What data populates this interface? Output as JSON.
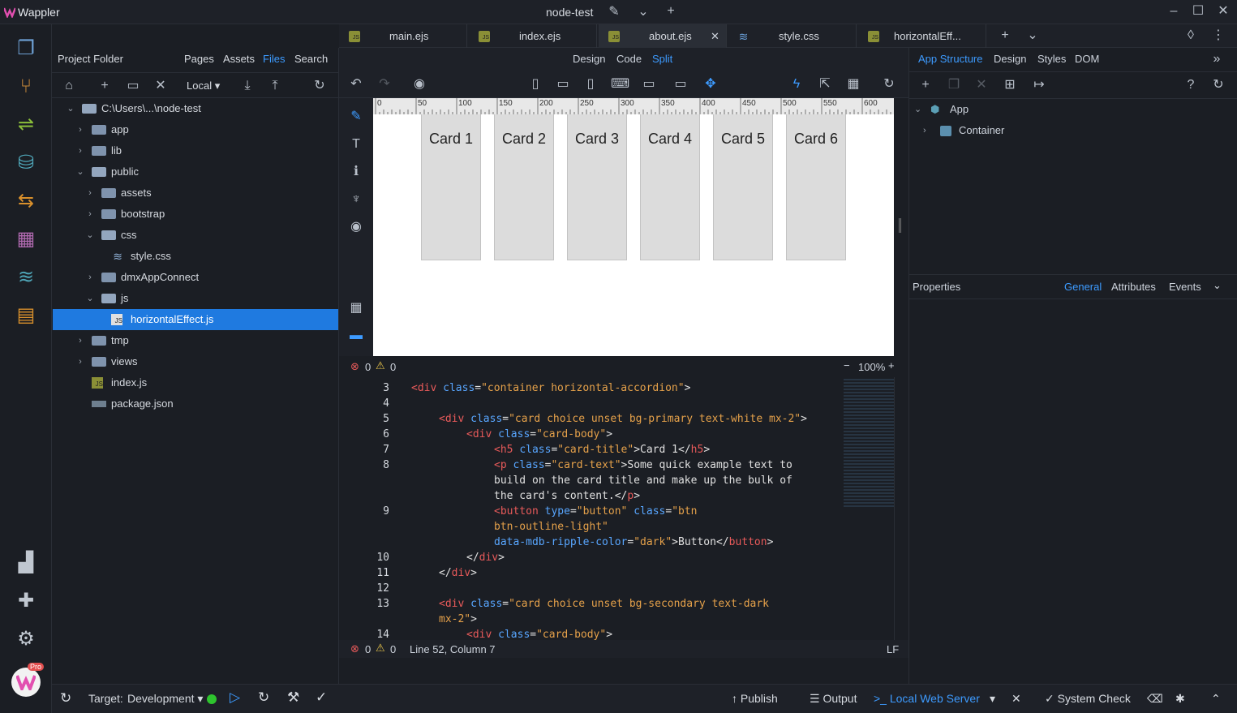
{
  "app": {
    "name": "Wappler",
    "project": "node-test"
  },
  "file_tabs": [
    {
      "label": "main.ejs",
      "icon": "js-file-icon",
      "active": false
    },
    {
      "label": "index.ejs",
      "icon": "js-file-icon",
      "active": false
    },
    {
      "label": "about.ejs",
      "icon": "js-file-icon",
      "active": true
    },
    {
      "label": "style.css",
      "icon": "css-file-icon",
      "active": false
    },
    {
      "label": "horizontalEff...",
      "icon": "js-file-icon",
      "active": false
    }
  ],
  "project_panel": {
    "title": "Project Folder",
    "tabs": [
      "Pages",
      "Assets",
      "Files",
      "Search"
    ],
    "active_tab": "Files",
    "location": "Local",
    "tree": [
      {
        "label": "C:\\Users\\...\\node-test",
        "depth": 0,
        "type": "folder-open"
      },
      {
        "label": "app",
        "depth": 1,
        "type": "folder"
      },
      {
        "label": "lib",
        "depth": 1,
        "type": "folder"
      },
      {
        "label": "public",
        "depth": 1,
        "type": "folder-open"
      },
      {
        "label": "assets",
        "depth": 2,
        "type": "folder"
      },
      {
        "label": "bootstrap",
        "depth": 2,
        "type": "folder"
      },
      {
        "label": "css",
        "depth": 2,
        "type": "folder-open"
      },
      {
        "label": "style.css",
        "depth": 3,
        "type": "css"
      },
      {
        "label": "dmxAppConnect",
        "depth": 2,
        "type": "folder"
      },
      {
        "label": "js",
        "depth": 2,
        "type": "folder-open"
      },
      {
        "label": "horizontalEffect.js",
        "depth": 3,
        "type": "js",
        "selected": true
      },
      {
        "label": "tmp",
        "depth": 1,
        "type": "folder"
      },
      {
        "label": "views",
        "depth": 1,
        "type": "folder"
      },
      {
        "label": "index.js",
        "depth": 1,
        "type": "js"
      },
      {
        "label": "package.json",
        "depth": 1,
        "type": "json"
      }
    ]
  },
  "view_modes": {
    "design": "Design",
    "code": "Code",
    "split": "Split",
    "active": "Split"
  },
  "ruler_ticks": [
    "0",
    "50",
    "100",
    "150",
    "200",
    "250",
    "300",
    "350",
    "400",
    "450",
    "500",
    "550",
    "600"
  ],
  "cards": [
    "Card 1",
    "Card 2",
    "Card 3",
    "Card 4",
    "Card 5",
    "Card 6"
  ],
  "canvas_status": {
    "errors": "0",
    "warnings": "0",
    "zoom": "100%"
  },
  "code_lines": [
    {
      "n": "3",
      "html": "<span class='etag'>&lt;div</span> <span class='att'>class</span>=<span class='str'>\"container horizontal-accordion\"</span>&gt;",
      "indent": 0
    },
    {
      "n": "4",
      "html": "",
      "indent": 0
    },
    {
      "n": "5",
      "html": "<span class='etag'>&lt;div</span> <span class='att'>class</span>=<span class='str'>\"card choice unset bg-primary text-white mx-2\"</span>&gt;",
      "indent": 1
    },
    {
      "n": "6",
      "html": "<span class='etag'>&lt;div</span> <span class='att'>class</span>=<span class='str'>\"card-body\"</span>&gt;",
      "indent": 2
    },
    {
      "n": "7",
      "html": "<span class='etag'>&lt;h5</span> <span class='att'>class</span>=<span class='str'>\"card-title\"</span>&gt;Card 1&lt;/<span class='etag'>h5</span>&gt;",
      "indent": 3
    },
    {
      "n": "8",
      "html": "<span class='etag'>&lt;p</span> <span class='att'>class</span>=<span class='str'>\"card-text\"</span>&gt;Some quick example text to",
      "indent": 3
    },
    {
      "n": "",
      "html": "build on the card title and make up the bulk of",
      "indent": 3
    },
    {
      "n": "",
      "html": "the card's content.&lt;/<span class='etag'>p</span>&gt;",
      "indent": 3
    },
    {
      "n": "9",
      "html": "<span class='etag'>&lt;button</span> <span class='att'>type</span>=<span class='str'>\"button\"</span> <span class='att'>class</span>=<span class='str'>\"btn</span>",
      "indent": 3
    },
    {
      "n": "",
      "html": "<span class='str'>btn-outline-light\"</span>",
      "indent": 3
    },
    {
      "n": "",
      "html": "<span class='att'>data-mdb-ripple-color</span>=<span class='str'>\"dark\"</span>&gt;Button&lt;/<span class='etag'>button</span>&gt;",
      "indent": 3
    },
    {
      "n": "10",
      "html": "&lt;/<span class='etag'>div</span>&gt;",
      "indent": 2
    },
    {
      "n": "11",
      "html": "&lt;/<span class='etag'>div</span>&gt;",
      "indent": 1
    },
    {
      "n": "12",
      "html": "",
      "indent": 0
    },
    {
      "n": "13",
      "html": "<span class='etag'>&lt;div</span> <span class='att'>class</span>=<span class='str'>\"card choice unset bg-secondary text-dark</span>",
      "indent": 1
    },
    {
      "n": "",
      "html": "<span class='str'>mx-2\"</span>&gt;",
      "indent": 1
    },
    {
      "n": "14",
      "html": "<span class='etag'>&lt;div</span> <span class='att'>class</span>=<span class='str'>\"card-body\"</span>&gt;",
      "indent": 2
    }
  ],
  "code_status": {
    "errors": "0",
    "warnings": "0",
    "position": "Line 52, Column 7",
    "eol": "LF"
  },
  "right_panel": {
    "tabs": [
      "App Structure",
      "Design",
      "Styles",
      "DOM"
    ],
    "active_tab": "App Structure",
    "tree": [
      {
        "label": "App",
        "depth": 0
      },
      {
        "label": "Container",
        "depth": 1
      }
    ],
    "properties_title": "Properties",
    "prop_tabs": [
      "General",
      "Attributes",
      "Events"
    ],
    "active_prop_tab": "General"
  },
  "bottom_bar": {
    "target_label": "Target:",
    "target_value": "Development",
    "publish": "Publish",
    "output": "Output",
    "server": "Local Web Server",
    "system_check": "System Check",
    "pro_badge": "Pro"
  },
  "colors": {
    "accent": "#1f7ae0",
    "link": "#3d9bff",
    "status_ok": "#2ec42e"
  }
}
